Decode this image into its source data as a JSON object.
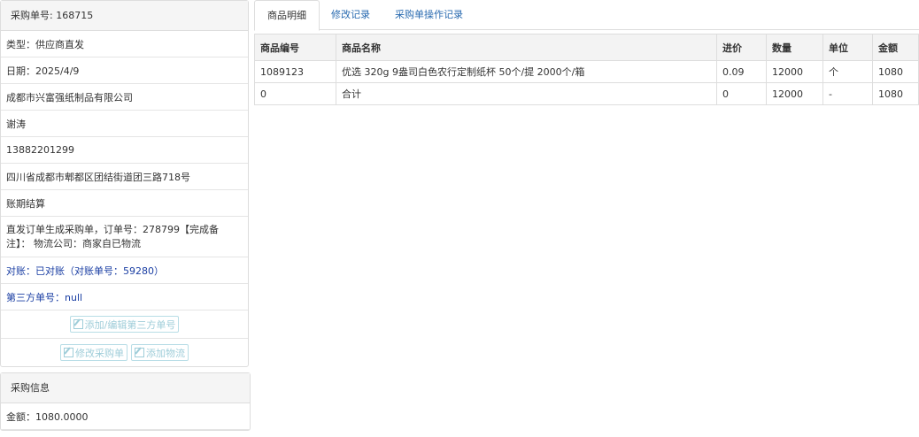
{
  "order": {
    "header": "采购单号: 168715",
    "type": "类型：供应商直发",
    "date": "日期：2025/4/9",
    "supplier": "成都市兴富强纸制品有限公司",
    "contact": "谢涛",
    "phone": "13882201299",
    "address": "四川省成都市郫都区团结街道团三路718号",
    "payment": "账期结算",
    "note": "直发订单生成采购单，订单号：278799【完成备注】： 物流公司：商家自已物流",
    "reconcile": "对账：已对账（对账单号：59280）",
    "third_party": "第三方单号：null",
    "btn_edit_third": "添加/编辑第三方单号",
    "btn_edit_order": "修改采购单",
    "btn_add_logistics": "添加物流"
  },
  "purchase_info": {
    "header": "采购信息",
    "amount": "金额：1080.0000"
  },
  "tabs": [
    "商品明细",
    "修改记录",
    "采购单操作记录"
  ],
  "table": {
    "columns": [
      "商品编号",
      "商品名称",
      "进价",
      "数量",
      "单位",
      "金额"
    ],
    "rows": [
      [
        "1089123",
        "优选 320g 9盎司白色农行定制纸杯 50个/提 2000个/箱",
        "0.09",
        "12000",
        "个",
        "1080"
      ],
      [
        "0",
        "合计",
        "0",
        "12000",
        "-",
        "1080"
      ]
    ]
  }
}
